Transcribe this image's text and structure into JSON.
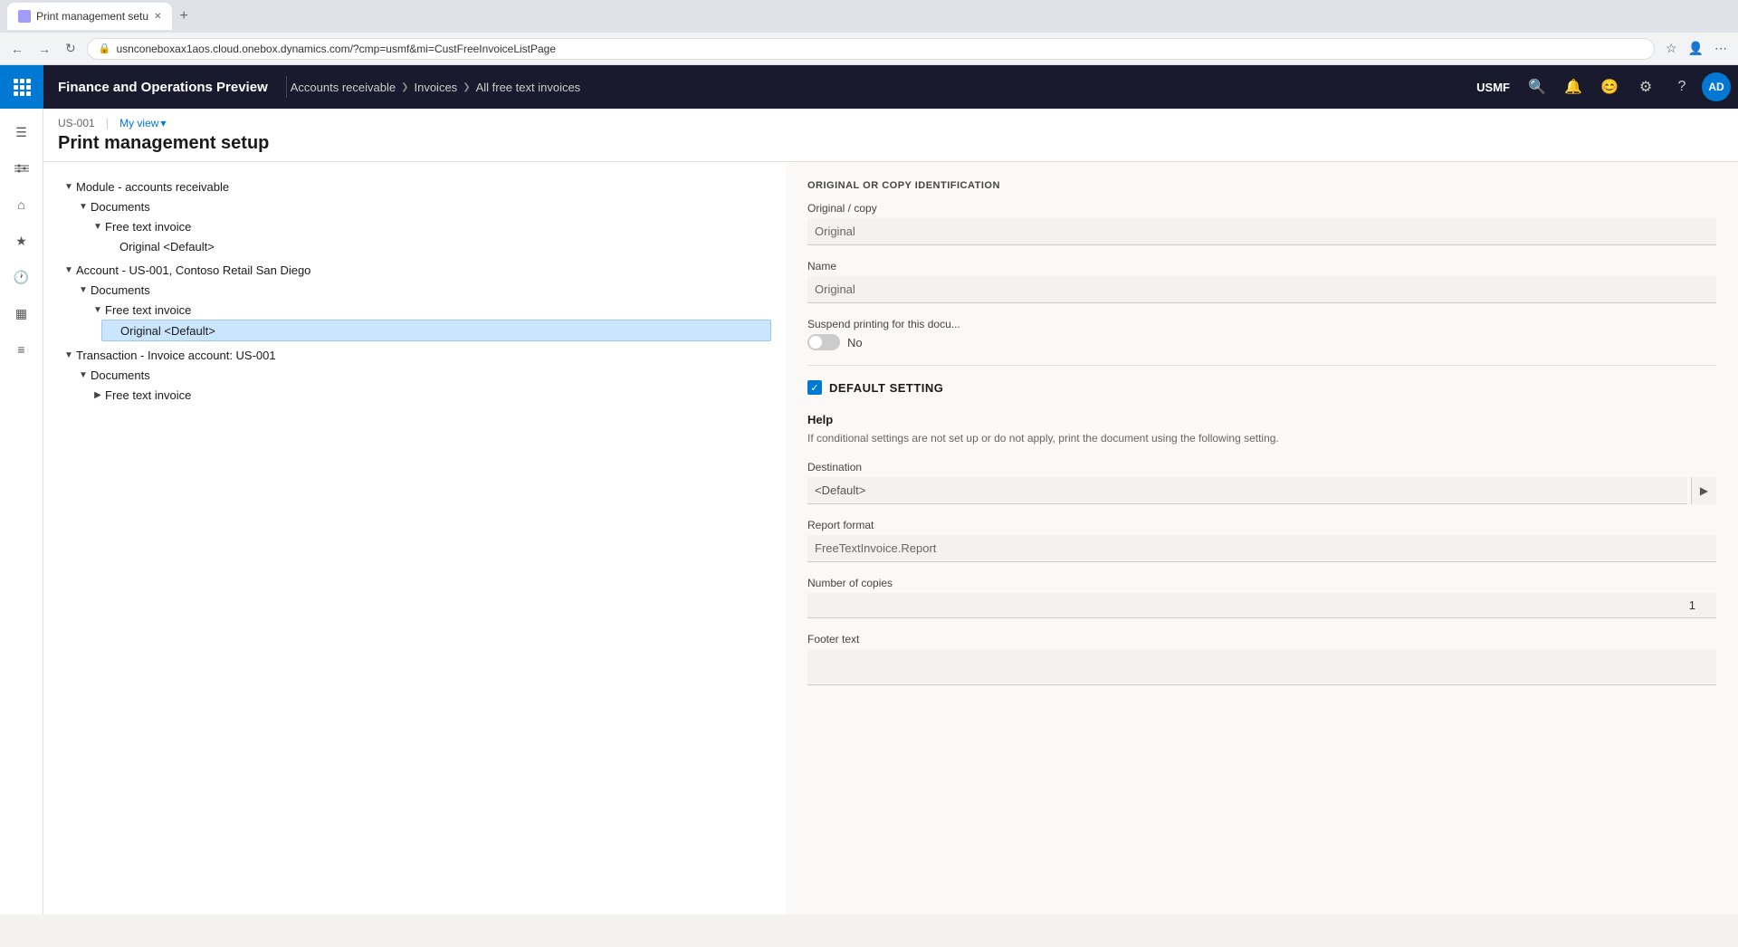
{
  "browser": {
    "tab_title": "Print management setu",
    "url": "usnconeboxax1aos.cloud.onebox.dynamics.com/?cmp=usmf&mi=CustFreeInvoiceListPage",
    "new_tab_label": "+",
    "back_label": "←",
    "forward_label": "→",
    "reload_label": "↻",
    "extensions_label": "⋯"
  },
  "navbar": {
    "app_title": "Finance and Operations Preview",
    "breadcrumbs": [
      {
        "label": "Accounts receivable"
      },
      {
        "label": "Invoices"
      },
      {
        "label": "All free text invoices"
      }
    ],
    "org_code": "USMF",
    "search_tooltip": "Search",
    "notifications_tooltip": "Notifications",
    "feedback_tooltip": "Feedback",
    "settings_tooltip": "Settings",
    "help_tooltip": "Help",
    "avatar_label": "AD"
  },
  "sidebar": {
    "menu_icon": "☰",
    "filter_icon": "⊞",
    "home_icon": "⌂",
    "favorites_icon": "★",
    "recent_icon": "🕐",
    "workspaces_icon": "▦",
    "modules_icon": "≡"
  },
  "subheader": {
    "company": "US-001",
    "separator": "|",
    "view": "My view",
    "view_chevron": "▾",
    "page_title": "Print management setup"
  },
  "tree": {
    "nodes": [
      {
        "id": "module",
        "toggle": "▼",
        "label": "Module - accounts receivable",
        "children": [
          {
            "id": "documents1",
            "toggle": "▼",
            "label": "Documents",
            "children": [
              {
                "id": "fti1",
                "toggle": "▼",
                "label": "Free text invoice",
                "children": [
                  {
                    "id": "original_default1",
                    "toggle": "",
                    "label": "Original <Default>",
                    "selected": false
                  }
                ]
              }
            ]
          }
        ]
      },
      {
        "id": "account",
        "toggle": "▼",
        "label": "Account - US-001, Contoso Retail San Diego",
        "children": [
          {
            "id": "documents2",
            "toggle": "▼",
            "label": "Documents",
            "children": [
              {
                "id": "fti2",
                "toggle": "▼",
                "label": "Free text invoice",
                "children": [
                  {
                    "id": "original_default2",
                    "toggle": "",
                    "label": "Original <Default>",
                    "selected": true
                  }
                ]
              }
            ]
          }
        ]
      },
      {
        "id": "transaction",
        "toggle": "▼",
        "label": "Transaction - Invoice account: US-001",
        "children": [
          {
            "id": "documents3",
            "toggle": "▼",
            "label": "Documents",
            "children": [
              {
                "id": "fti3",
                "toggle": "▶",
                "label": "Free text invoice",
                "children": []
              }
            ]
          }
        ]
      }
    ]
  },
  "right_panel": {
    "section_title": "ORIGINAL OR COPY IDENTIFICATION",
    "fields": {
      "original_copy_label": "Original / copy",
      "original_copy_value": "Original",
      "name_label": "Name",
      "name_value": "Original",
      "suspend_label": "Suspend printing for this docu...",
      "suspend_toggle_state": "off",
      "suspend_no": "No"
    },
    "default_setting": {
      "checkbox_checked": true,
      "section_label": "DEFAULT SETTING",
      "help_title": "Help",
      "help_text": "If conditional settings are not set up or do not apply, print the document using the following setting.",
      "destination_label": "Destination",
      "destination_value": "<Default>",
      "report_format_label": "Report format",
      "report_format_value": "FreeTextInvoice.Report",
      "number_of_copies_label": "Number of copies",
      "number_of_copies_value": "1",
      "footer_text_label": "Footer text"
    }
  }
}
